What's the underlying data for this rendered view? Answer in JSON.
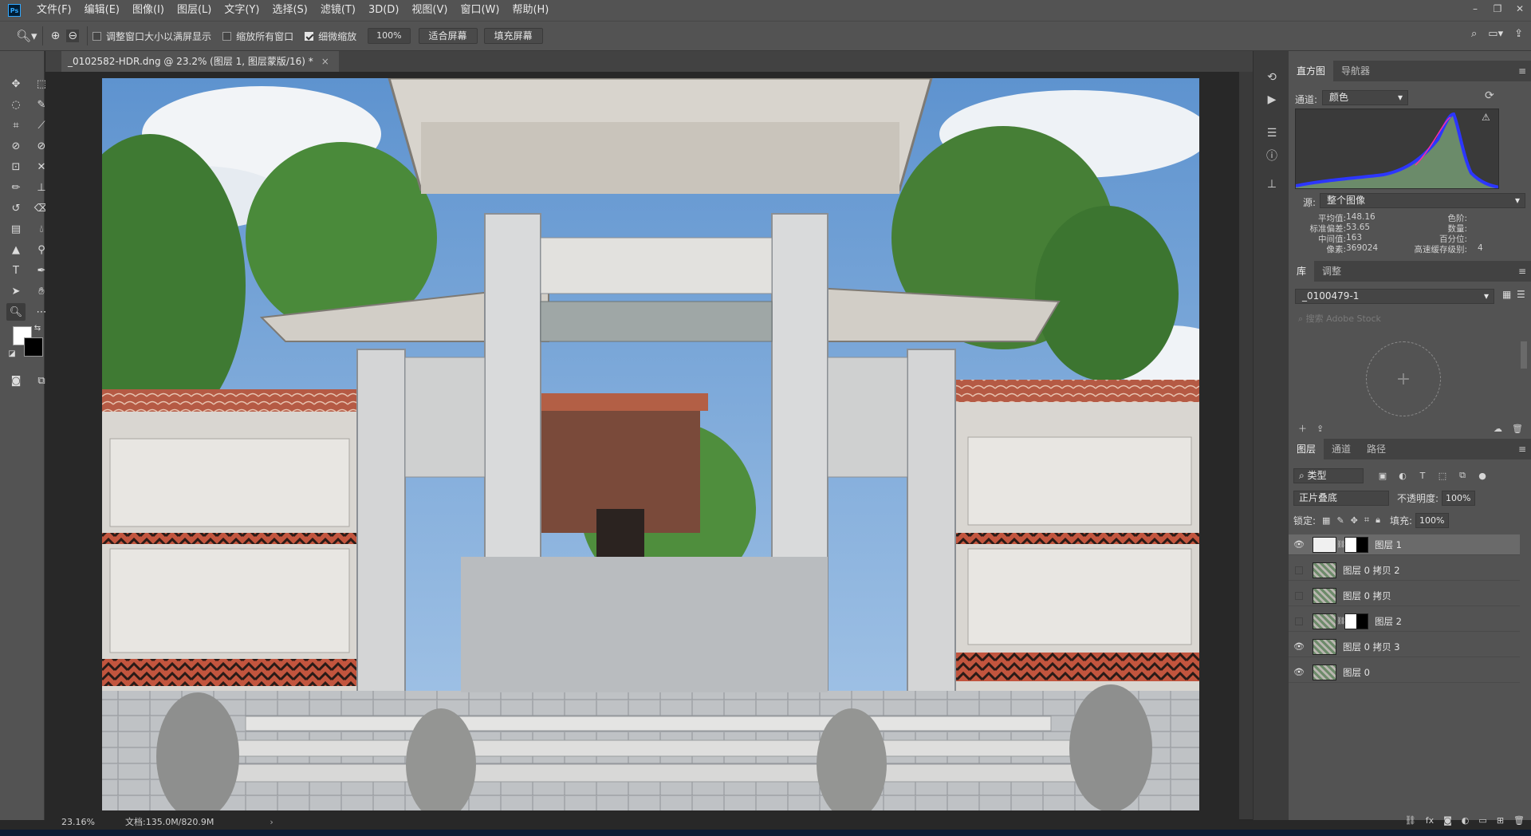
{
  "app": {
    "logo": "Ps",
    "menu": [
      "文件(F)",
      "编辑(E)",
      "图像(I)",
      "图层(L)",
      "文字(Y)",
      "选择(S)",
      "滤镜(T)",
      "3D(D)",
      "视图(V)",
      "窗口(W)",
      "帮助(H)"
    ],
    "window_controls": [
      "–",
      "❐",
      "✕"
    ]
  },
  "options": {
    "resize_windows": "调整窗口大小以满屏显示",
    "zoom_all": "缩放所有窗口",
    "scrubby_zoom": "细微缩放",
    "zoom_value": "100%",
    "fit_screen": "适合屏幕",
    "fill_screen": "填充屏幕"
  },
  "document": {
    "tab_title": "_0102582-HDR.dng @ 23.2% (图层 1, 图层蒙版/16) *",
    "tab_close": "×",
    "zoom": "23.16%",
    "doc_size": "文档:135.0M/820.9M",
    "status_arrow": "›"
  },
  "histogram": {
    "tabs": [
      "直方图",
      "导航器"
    ],
    "channel_label": "通道:",
    "channel": "颜色",
    "source_label": "源:",
    "source": "整个图像",
    "stats": {
      "mean_label": "平均值:",
      "mean": "148.16",
      "std_label": "标准偏差:",
      "std": "53.65",
      "median_label": "中间值:",
      "median": "163",
      "pixels_label": "像素:",
      "pixels": "369024",
      "level_label": "色阶:",
      "level": "",
      "count_label": "数量:",
      "count": "",
      "percentile_label": "百分位:",
      "percentile": "",
      "cache_label": "高速缓存级别:",
      "cache": "4"
    }
  },
  "library": {
    "tabs": [
      "库",
      "调整"
    ],
    "selected": "_0100479-1",
    "search_placeholder": "搜索 Adobe Stock",
    "add": "+"
  },
  "layers": {
    "tabs": [
      "图层",
      "通道",
      "路径"
    ],
    "filter": "类型",
    "blend_mode": "正片叠底",
    "opacity_label": "不透明度:",
    "opacity": "100%",
    "lock_label": "锁定:",
    "fill_label": "填充:",
    "fill": "100%",
    "items": [
      {
        "name": "图层 1",
        "visible": true,
        "selected": true,
        "mask": true,
        "thumb": "white"
      },
      {
        "name": "图层 0 拷贝 2",
        "visible": false,
        "selected": false,
        "mask": false,
        "thumb": "photo"
      },
      {
        "name": "图层 0 拷贝",
        "visible": false,
        "selected": false,
        "mask": false,
        "thumb": "photo"
      },
      {
        "name": "图层 2",
        "visible": false,
        "selected": false,
        "mask": true,
        "thumb": "photo"
      },
      {
        "name": "图层 0 拷贝 3",
        "visible": true,
        "selected": false,
        "mask": false,
        "thumb": "photo"
      },
      {
        "name": "图层 0",
        "visible": true,
        "selected": false,
        "mask": false,
        "thumb": "photo"
      }
    ]
  },
  "colors": {
    "foreground": "#ffffff",
    "background": "#000000",
    "accent": "#31a8ff"
  }
}
